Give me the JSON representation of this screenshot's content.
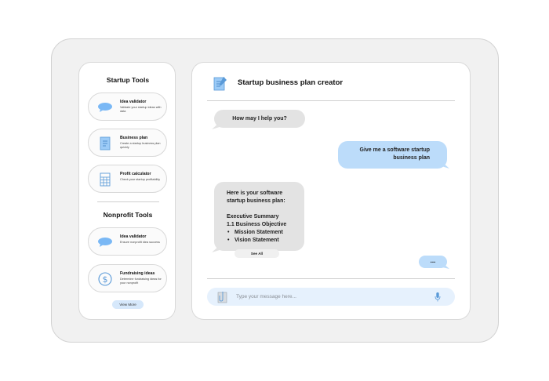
{
  "sidebar": {
    "startup_heading": "Startup Tools",
    "startup_tools": [
      {
        "title": "Idea validator",
        "desc": "Validate your startup ideas with data",
        "icon": "speech-bubble-icon"
      },
      {
        "title": "Business plan",
        "desc": "Create a startup business plan quickly",
        "icon": "document-icon"
      },
      {
        "title": "Profit calculator",
        "desc": "Check your startup profitability",
        "icon": "calculator-icon"
      }
    ],
    "nonprofit_heading": "Nonprofit Tools",
    "nonprofit_tools": [
      {
        "title": "Idea validator",
        "desc": "Ensure nonprofit idea success",
        "icon": "speech-bubble-icon"
      },
      {
        "title": "Fundraising ideas",
        "desc": "Determine fundraising ideas for your nonprofit",
        "icon": "dollar-circle-icon"
      }
    ],
    "view_more": "View More"
  },
  "chat": {
    "title": "Startup business plan creator",
    "bot_greeting": "How may I help you?",
    "user_message_line1": "Give me a software startup",
    "user_message_line2": "business plan",
    "response": {
      "line1": "Here is your software",
      "line2": "startup business plan:",
      "section": "Executive Summary",
      "subsection": "1.1 Business Objective",
      "bullets": [
        "Mission Statement",
        "Vision Statement"
      ]
    },
    "see_all": "See All",
    "typing": "...",
    "input_placeholder": "Type your message here..."
  },
  "colors": {
    "accent_blue": "#bcdcfa",
    "icon_blue": "#7ab8f5",
    "bot_bubble": "#e3e3e3",
    "input_bg": "#e6f1fd"
  }
}
